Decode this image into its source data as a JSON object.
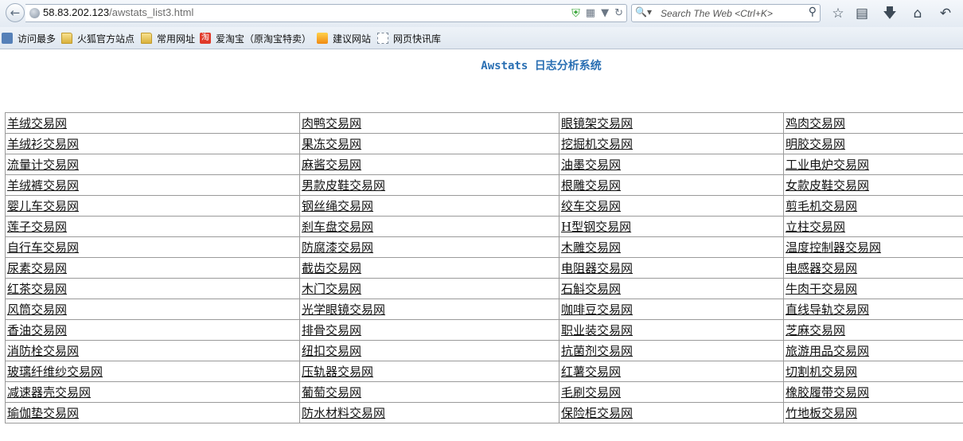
{
  "browser": {
    "url_host": "58.83.202.123",
    "url_path": "/awstats_list3.html",
    "search_placeholder": "Search The Web <Ctrl+K>"
  },
  "bookmarks": [
    {
      "label": "访问最多",
      "icon": "most-visited-icon"
    },
    {
      "label": "火狐官方站点",
      "icon": "folder-icon"
    },
    {
      "label": "常用网址",
      "icon": "folder-icon"
    },
    {
      "label": "爱淘宝（原淘宝特卖）",
      "icon": "taobao-icon"
    },
    {
      "label": "建议网站",
      "icon": "suggested-sites-icon"
    },
    {
      "label": "网页快讯库",
      "icon": "web-slice-icon"
    }
  ],
  "page": {
    "title": "Awstats 日志分析系统"
  },
  "links": [
    [
      "羊绒交易网",
      "肉鸭交易网",
      "眼镜架交易网",
      "鸡肉交易网"
    ],
    [
      "羊绒衫交易网",
      "果冻交易网",
      "挖掘机交易网",
      "明胶交易网"
    ],
    [
      "流量计交易网",
      "麻酱交易网",
      "油墨交易网",
      "工业电炉交易网"
    ],
    [
      "羊绒裤交易网",
      "男款皮鞋交易网",
      "根雕交易网",
      "女款皮鞋交易网"
    ],
    [
      "婴儿车交易网",
      "钢丝绳交易网",
      "绞车交易网",
      "剪毛机交易网"
    ],
    [
      "莲子交易网",
      "刹车盘交易网",
      "H型钢交易网",
      "立柱交易网"
    ],
    [
      "自行车交易网",
      "防腐漆交易网",
      "木雕交易网",
      "温度控制器交易网"
    ],
    [
      "尿素交易网",
      "截齿交易网",
      "电阻器交易网",
      "电感器交易网"
    ],
    [
      "红茶交易网",
      "木门交易网",
      "石斛交易网",
      "牛肉干交易网"
    ],
    [
      "风筒交易网",
      "光学眼镜交易网",
      "咖啡豆交易网",
      "直线导轨交易网"
    ],
    [
      "香油交易网",
      "排骨交易网",
      "职业装交易网",
      "芝麻交易网"
    ],
    [
      "消防栓交易网",
      "纽扣交易网",
      "抗菌剂交易网",
      "旅游用品交易网"
    ],
    [
      "玻璃纤维纱交易网",
      "压轨器交易网",
      "红薯交易网",
      "切割机交易网"
    ],
    [
      "减速器壳交易网",
      "葡萄交易网",
      "毛刷交易网",
      "橡胶履带交易网"
    ],
    [
      "瑜伽垫交易网",
      "防水材料交易网",
      "保险柜交易网",
      "竹地板交易网"
    ]
  ]
}
